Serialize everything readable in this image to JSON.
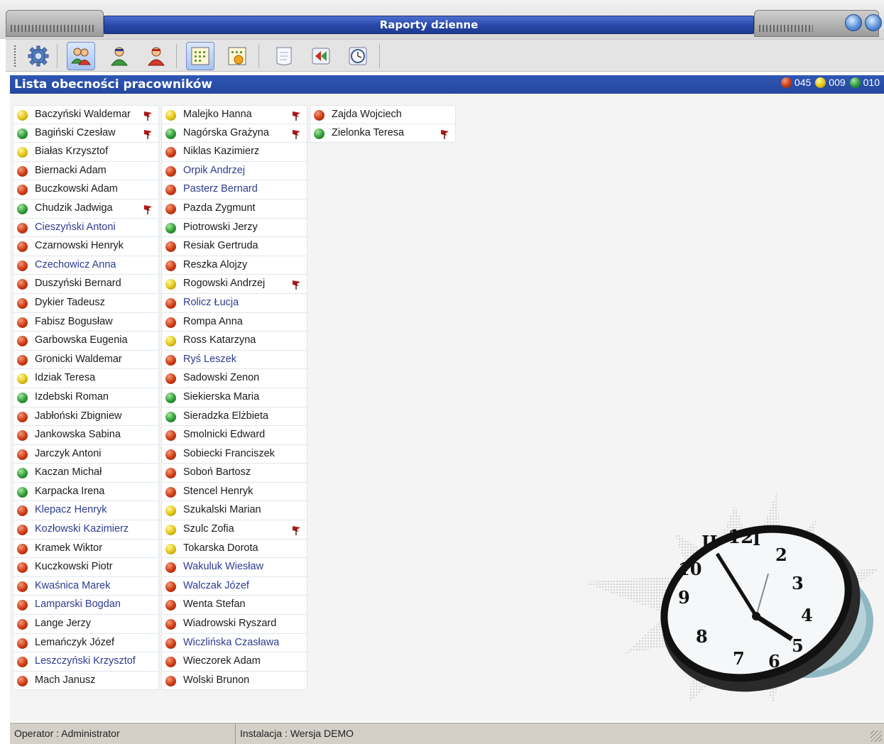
{
  "window": {
    "title": "Raporty dzienne"
  },
  "toolbar": {
    "buttons": [
      {
        "icon": "gear-icon"
      },
      {
        "icon": "users-icon",
        "active": true
      },
      {
        "icon": "user-green-icon"
      },
      {
        "icon": "user-red-icon"
      },
      {
        "icon": "grid-calendar-icon",
        "active": true
      },
      {
        "icon": "calendar-sun-icon"
      },
      {
        "icon": "notepad-icon"
      },
      {
        "icon": "back-arrows-icon"
      },
      {
        "icon": "clock-icon"
      }
    ]
  },
  "header": {
    "title": "Lista obecności pracowników",
    "counts": [
      {
        "status": "red",
        "value": "045"
      },
      {
        "status": "yellow",
        "value": "009"
      },
      {
        "status": "green",
        "value": "010"
      }
    ]
  },
  "colors": {
    "red": "#cc3a12",
    "yellow": "#e2c411",
    "green": "#2e9a35",
    "flag": "#b01818",
    "header_blue": "#2648a5",
    "name_blue": "#2d3b8f"
  },
  "employees": [
    [
      {
        "name": "Baczyński Waldemar",
        "status": "yellow",
        "flag": true
      },
      {
        "name": "Bagiński Czesław",
        "status": "green",
        "flag": true
      },
      {
        "name": "Białas Krzysztof",
        "status": "yellow"
      },
      {
        "name": "Biernacki Adam",
        "status": "red"
      },
      {
        "name": "Buczkowski Adam",
        "status": "red"
      },
      {
        "name": "Chudzik Jadwiga",
        "status": "green",
        "flag": true
      },
      {
        "name": "Cieszyński Antoni",
        "status": "red",
        "blue": true
      },
      {
        "name": "Czarnowski Henryk",
        "status": "red"
      },
      {
        "name": "Czechowicz Anna",
        "status": "red",
        "blue": true
      },
      {
        "name": "Duszyński Bernard",
        "status": "red"
      },
      {
        "name": "Dykier Tadeusz",
        "status": "red"
      },
      {
        "name": "Fabisz Bogusław",
        "status": "red"
      },
      {
        "name": "Garbowska Eugenia",
        "status": "red"
      },
      {
        "name": "Gronicki Waldemar",
        "status": "red"
      },
      {
        "name": "Idziak Teresa",
        "status": "yellow"
      },
      {
        "name": "Izdebski Roman",
        "status": "green"
      },
      {
        "name": "Jabłoński Zbigniew",
        "status": "red"
      },
      {
        "name": "Jankowska Sabina",
        "status": "red"
      },
      {
        "name": "Jarczyk Antoni",
        "status": "red"
      },
      {
        "name": "Kaczan Michał",
        "status": "green"
      },
      {
        "name": "Karpacka Irena",
        "status": "green"
      },
      {
        "name": "Klepacz Henryk",
        "status": "red",
        "blue": true
      },
      {
        "name": "Kozłowski Kazimierz",
        "status": "red",
        "blue": true
      },
      {
        "name": "Kramek Wiktor",
        "status": "red"
      },
      {
        "name": "Kuczkowski Piotr",
        "status": "red"
      },
      {
        "name": "Kwaśnica Marek",
        "status": "red",
        "blue": true
      },
      {
        "name": "Lamparski Bogdan",
        "status": "red",
        "blue": true
      },
      {
        "name": "Lange Jerzy",
        "status": "red"
      },
      {
        "name": "Lemańczyk Józef",
        "status": "red"
      },
      {
        "name": "Leszczyński Krzysztof",
        "status": "red",
        "blue": true
      },
      {
        "name": "Mach Janusz",
        "status": "red"
      }
    ],
    [
      {
        "name": "Malejko Hanna",
        "status": "yellow",
        "flag": true
      },
      {
        "name": "Nagórska Grażyna",
        "status": "green",
        "flag": true
      },
      {
        "name": "Niklas Kazimierz",
        "status": "red"
      },
      {
        "name": "Orpik Andrzej",
        "status": "red",
        "blue": true
      },
      {
        "name": "Pasterz Bernard",
        "status": "red",
        "blue": true
      },
      {
        "name": "Pazda Zygmunt",
        "status": "red"
      },
      {
        "name": "Piotrowski Jerzy",
        "status": "green"
      },
      {
        "name": "Resiak Gertruda",
        "status": "red"
      },
      {
        "name": "Reszka Alojzy",
        "status": "red"
      },
      {
        "name": "Rogowski Andrzej",
        "status": "yellow",
        "flag": true
      },
      {
        "name": "Rolicz Łucja",
        "status": "red",
        "blue": true
      },
      {
        "name": "Rompa Anna",
        "status": "red"
      },
      {
        "name": "Ross Katarzyna",
        "status": "yellow"
      },
      {
        "name": "Ryś Leszek",
        "status": "red",
        "blue": true
      },
      {
        "name": "Sadowski Zenon",
        "status": "red"
      },
      {
        "name": "Siekierska Maria",
        "status": "green"
      },
      {
        "name": "Sieradzka Elżbieta",
        "status": "green"
      },
      {
        "name": "Smolnicki Edward",
        "status": "red"
      },
      {
        "name": "Sobiecki Franciszek",
        "status": "red"
      },
      {
        "name": "Soboń Bartosz",
        "status": "red"
      },
      {
        "name": "Stencel Henryk",
        "status": "red"
      },
      {
        "name": "Szukalski Marian",
        "status": "yellow"
      },
      {
        "name": "Szulc Zofia",
        "status": "yellow",
        "flag": true
      },
      {
        "name": "Tokarska Dorota",
        "status": "yellow"
      },
      {
        "name": "Wakuluk Wiesław",
        "status": "red",
        "blue": true
      },
      {
        "name": "Walczak Józef",
        "status": "red",
        "blue": true
      },
      {
        "name": "Wenta Stefan",
        "status": "red"
      },
      {
        "name": "Wiadrowski Ryszard",
        "status": "red"
      },
      {
        "name": "Wiczlińska Czasława",
        "status": "red",
        "blue": true
      },
      {
        "name": "Wieczorek Adam",
        "status": "red"
      },
      {
        "name": "Wolski Brunon",
        "status": "red"
      }
    ],
    [
      {
        "name": "Zajda Wojciech",
        "status": "red"
      },
      {
        "name": "Zielonka Teresa",
        "status": "green",
        "flag": true
      }
    ]
  ],
  "statusbar": {
    "operator": "Operator : Administrator",
    "installation": "Instalacja : Wersja DEMO"
  }
}
